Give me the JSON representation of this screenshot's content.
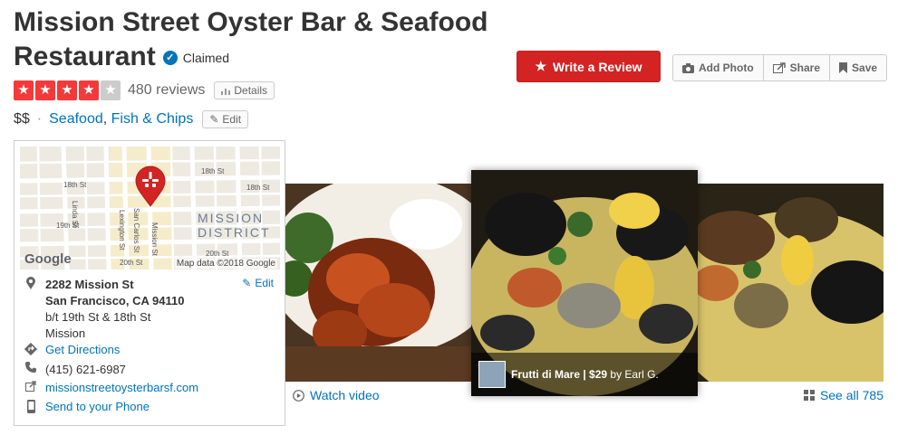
{
  "business": {
    "name": "Mission Street Oyster Bar & Seafood Restaurant",
    "claimed_label": "Claimed",
    "rating": 4,
    "rating_max": 5,
    "review_count": "480 reviews",
    "details_label": "Details",
    "price": "$$",
    "categories": [
      "Seafood",
      "Fish & Chips"
    ],
    "edit_label": "Edit"
  },
  "actions": {
    "write_review": "Write a Review",
    "add_photo": "Add Photo",
    "share": "Share",
    "save": "Save"
  },
  "map": {
    "attribution": "Map data ©2018 Google",
    "logo": "Google",
    "district_label_1": "MISSION",
    "district_label_2": "DISTRICT",
    "streets": [
      "18th St",
      "18th St",
      "19th St",
      "20th St",
      "20th St",
      "Linda St",
      "Lexington St",
      "San Carlos St",
      "Mission St",
      "18th St"
    ]
  },
  "info": {
    "address_line1": "2282 Mission St",
    "address_line2": "San Francisco, CA 94110",
    "cross_streets": "b/t 19th St & 18th St",
    "neighborhood": "Mission",
    "edit_label": "Edit",
    "directions": "Get Directions",
    "phone": "(415) 621-6987",
    "website": "missionstreetoysterbarsf.com",
    "send_phone": "Send to your Phone"
  },
  "photos": {
    "caption_title": "Frutti di Mare | $29",
    "caption_by": "by Earl G.",
    "watch_video": "Watch video",
    "see_all": "See all 785"
  },
  "colors": {
    "brand_red": "#d32323",
    "star_red": "#f43939",
    "link_blue": "#0073bb"
  }
}
